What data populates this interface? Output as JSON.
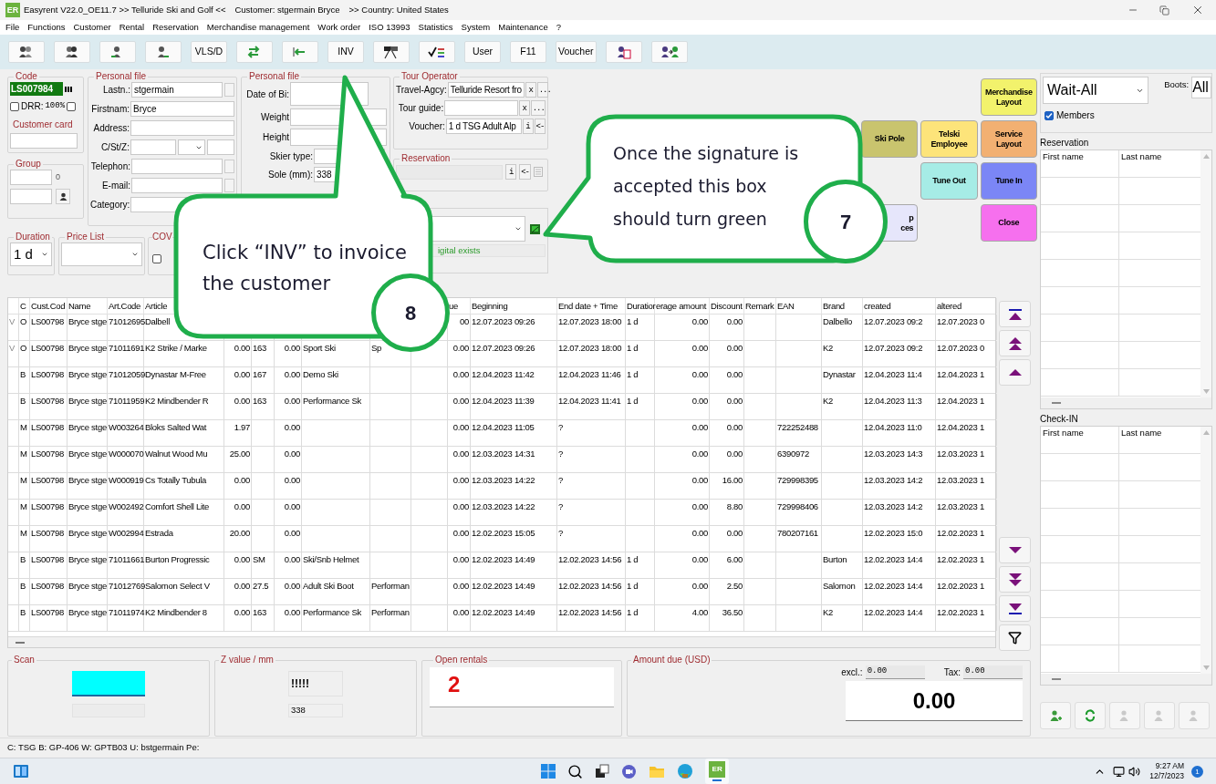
{
  "window": {
    "app_badge": "ER",
    "title": "Easyrent V22.0_OE11.7 >> Telluride Ski and Golf <<",
    "customer": "Customer: stgermain Bryce",
    "country": ">> Country: United States"
  },
  "menu": [
    "File",
    "Functions",
    "Customer",
    "Rental",
    "Reservation",
    "Merchandise management",
    "Work order",
    "ISO 13993",
    "Statistics",
    "System",
    "Maintenance",
    "?"
  ],
  "toolbar": [
    {
      "kind": "icon"
    },
    {
      "kind": "icon"
    },
    {
      "kind": "icon"
    },
    {
      "kind": "icon"
    },
    {
      "kind": "text",
      "label": "VLS/D"
    },
    {
      "kind": "icon"
    },
    {
      "kind": "icon"
    },
    {
      "kind": "text",
      "label": "INV"
    },
    {
      "kind": "icon"
    },
    {
      "kind": "icon"
    },
    {
      "kind": "text",
      "label": "User"
    },
    {
      "kind": "text",
      "label": "F11"
    },
    {
      "kind": "text",
      "label": "Voucher"
    },
    {
      "kind": "icon"
    },
    {
      "kind": "icon"
    }
  ],
  "code": {
    "title": "Code",
    "value": "LS007984",
    "drr_label": "DRR:",
    "drr_value": "100%",
    "drr_checked": false,
    "extra_checked": false,
    "customer_card": "Customer card"
  },
  "group": {
    "title": "Group",
    "count": "0"
  },
  "personal_file": {
    "title": "Personal file",
    "fields": [
      {
        "label": "Lastn.:",
        "value": "stgermain",
        "kind": "action"
      },
      {
        "label": "Firstnam:",
        "value": "Bryce",
        "kind": "plain"
      },
      {
        "label": "Address:",
        "kind": "plain"
      },
      {
        "label": "C/St/Z:",
        "kind": "triple"
      },
      {
        "label": "Telephon:",
        "kind": "action"
      },
      {
        "label": "E-mail:",
        "kind": "action"
      },
      {
        "label": "Category:",
        "kind": "plain"
      }
    ]
  },
  "body_file": {
    "title": "Personal file",
    "fields": [
      {
        "label": "Date of Bi:",
        "kind": "tall"
      },
      {
        "label": "Weight",
        "kind": "wide"
      },
      {
        "label": "Height",
        "kind": "wide"
      },
      {
        "label": "Skier type:",
        "kind": "short"
      },
      {
        "label": "Sole (mm):",
        "value": "338",
        "kind": "short"
      }
    ]
  },
  "tour_operator": {
    "title": "Tour Operator",
    "fields": [
      {
        "label": "Travel-Agcy:",
        "value": "Telluride Resort fro",
        "buttons": [
          "x",
          "..."
        ]
      },
      {
        "label": "Tour guide:",
        "buttons": [
          "x",
          "..."
        ]
      },
      {
        "label": "Voucher:",
        "value": "1 d TSG Adult Alp",
        "buttons": [
          "i",
          "<-"
        ]
      }
    ]
  },
  "reservation": {
    "title": "Reservation",
    "buttons": [
      "i",
      "<-"
    ]
  },
  "signature": {
    "status": "igital exists"
  },
  "duration": {
    "title": "Duration",
    "value": "1 d"
  },
  "price_list": {
    "title": "Price List"
  },
  "cov": {
    "title": "COV",
    "checked": false
  },
  "quick_buttons": [
    {
      "kind": "gap"
    },
    {
      "kind": "gap"
    },
    {
      "kind": "button",
      "lines": [
        "Merchandise",
        "Layout"
      ],
      "color": "#f2f26c"
    },
    {
      "kind": "button",
      "lines": [
        "Ski Pole"
      ],
      "color": "#c9c46e"
    },
    {
      "kind": "button",
      "lines": [
        "Telski",
        "Employee"
      ],
      "color": "#fde47a"
    },
    {
      "kind": "button",
      "lines": [
        "Service",
        "Layout"
      ],
      "color": "#f2b072"
    },
    {
      "kind": "gap"
    },
    {
      "kind": "button",
      "lines": [
        "Tune Out"
      ],
      "color": "#a6ece6"
    },
    {
      "kind": "button",
      "lines": [
        "Tune In"
      ],
      "color": "#7b86f6"
    },
    {
      "kind": "partial",
      "lines": [
        "p",
        "ces"
      ],
      "color": "#e6e6fb"
    },
    {
      "kind": "gap"
    },
    {
      "kind": "button",
      "lines": [
        "Close"
      ],
      "color": "#f670ee"
    }
  ],
  "table": {
    "columns": [
      "",
      "C",
      "Cust.Cod",
      "Name",
      "Art.Code",
      "Article",
      "",
      "",
      "",
      "",
      "",
      "",
      "ue",
      "Beginning",
      "End date + Time",
      "Duratior",
      "erage amount",
      "Discount",
      "Remark",
      "EAN",
      "Brand",
      "created",
      "altered"
    ],
    "rows": [
      {
        "cells": [
          "V",
          "O",
          "LS00798",
          "Bryce stge",
          "71012695",
          "Dalbell",
          "",
          "",
          "",
          "",
          "",
          "",
          "00",
          "12.07.2023 09:26",
          "12.07.2023 18:00",
          "1 d",
          "0.00",
          "0.00",
          "",
          "",
          "Dalbello",
          "12.07.2023 09:2",
          "12.07.2023 0"
        ]
      },
      {
        "cells": [
          "V",
          "O",
          "LS00798",
          "Bryce stge",
          "71011691",
          "K2 Strike / Marke",
          "0.00",
          "163",
          "0.00",
          "Sport Ski",
          "Sp",
          "",
          "0.00",
          "12.07.2023 09:26",
          "12.07.2023 18:00",
          "1 d",
          "0.00",
          "0.00",
          "",
          "",
          "K2",
          "12.07.2023 09:2",
          "12.07.2023 0"
        ]
      },
      {
        "cells": [
          "",
          "B",
          "LS00798",
          "Bryce stge",
          "71012059",
          "Dynastar M-Free",
          "0.00",
          "167",
          "0.00",
          "Demo Ski",
          "",
          "",
          "0.00",
          "12.04.2023 11:42",
          "12.04.2023 11:46",
          "1 d",
          "0.00",
          "0.00",
          "",
          "",
          "Dynastar",
          "12.04.2023 11:4",
          "12.04.2023 1"
        ]
      },
      {
        "cells": [
          "",
          "B",
          "LS00798",
          "Bryce stge",
          "71011959",
          "K2 Mindbender R",
          "0.00",
          "163",
          "0.00",
          "Performance Sk",
          "",
          "",
          "0.00",
          "12.04.2023 11:39",
          "12.04.2023 11:41",
          "1 d",
          "0.00",
          "0.00",
          "",
          "",
          "K2",
          "12.04.2023 11:3",
          "12.04.2023 1"
        ]
      },
      {
        "cells": [
          "",
          "M",
          "LS00798",
          "Bryce stge",
          "W003264",
          "Bloks Salted Wat",
          "1.97",
          "",
          "0.00",
          "",
          "",
          "",
          "0.00",
          "12.04.2023 11:05",
          "?",
          "",
          "0.00",
          "0.00",
          "",
          "722252488",
          "",
          "12.04.2023 11:0",
          "12.04.2023 1"
        ]
      },
      {
        "cells": [
          "",
          "M",
          "LS00798",
          "Bryce stge",
          "W000070",
          "Walnut Wood Mu",
          "25.00",
          "",
          "0.00",
          "",
          "",
          "",
          "0.00",
          "12.03.2023 14:31",
          "?",
          "",
          "0.00",
          "0.00",
          "",
          "6390972",
          "",
          "12.03.2023 14:3",
          "12.03.2023 1"
        ]
      },
      {
        "cells": [
          "",
          "M",
          "LS00798",
          "Bryce stge",
          "W000919",
          "Cs Totally Tubula",
          "0.00",
          "",
          "0.00",
          "",
          "",
          "",
          "0.00",
          "12.03.2023 14:22",
          "?",
          "",
          "0.00",
          "16.00",
          "",
          "729998395",
          "",
          "12.03.2023 14:2",
          "12.03.2023 1"
        ]
      },
      {
        "cells": [
          "",
          "M",
          "LS00798",
          "Bryce stge",
          "W002492",
          "Comfort Shell Lite",
          "0.00",
          "",
          "0.00",
          "",
          "",
          "",
          "0.00",
          "12.03.2023 14:22",
          "?",
          "",
          "0.00",
          "8.80",
          "",
          "729998406",
          "",
          "12.03.2023 14:2",
          "12.03.2023 1"
        ]
      },
      {
        "cells": [
          "",
          "M",
          "LS00798",
          "Bryce stge",
          "W002994",
          "Estrada",
          "20.00",
          "",
          "0.00",
          "",
          "",
          "",
          "0.00",
          "12.02.2023 15:05",
          "?",
          "",
          "0.00",
          "0.00",
          "",
          "780207161",
          "",
          "12.02.2023 15:0",
          "12.02.2023 1"
        ]
      },
      {
        "cells": [
          "",
          "B",
          "LS00798",
          "Bryce stge",
          "71011661",
          "Burton Progressic",
          "0.00",
          "SM",
          "0.00",
          "Ski/Snb Helmet",
          "",
          "",
          "0.00",
          "12.02.2023 14:49",
          "12.02.2023 14:56",
          "1 d",
          "0.00",
          "6.00",
          "",
          "",
          "Burton",
          "12.02.2023 14:4",
          "12.02.2023 1"
        ]
      },
      {
        "cells": [
          "",
          "B",
          "LS00798",
          "Bryce stge",
          "71012769",
          "Salomon Select V",
          "0.00",
          "27.5",
          "0.00",
          "Adult Ski Boot",
          "Performan",
          "",
          "0.00",
          "12.02.2023 14:49",
          "12.02.2023 14:56",
          "1 d",
          "0.00",
          "2.50",
          "",
          "",
          "Salomon",
          "12.02.2023 14:4",
          "12.02.2023 1"
        ]
      },
      {
        "cells": [
          "",
          "B",
          "LS00798",
          "Bryce stge",
          "71011974",
          "K2 Mindbender 8",
          "0.00",
          "163",
          "0.00",
          "Performance Sk",
          "Performan",
          "",
          "0.00",
          "12.02.2023 14:49",
          "12.02.2023 14:56",
          "1 d",
          "4.00",
          "36.50",
          "",
          "",
          "K2",
          "12.02.2023 14:4",
          "12.02.2023 1"
        ]
      }
    ]
  },
  "scan": {
    "title": "Scan"
  },
  "z_value": {
    "title": "Z value / mm",
    "code": "!!!!!",
    "value": "338"
  },
  "open_rentals": {
    "title": "Open rentals",
    "value": "2"
  },
  "amount_due": {
    "title": "Amount due (USD)",
    "excl_label": "excl.:",
    "excl": "0.00",
    "tax_label": "Tax:",
    "tax": "0.00",
    "total": "0.00"
  },
  "side": {
    "filter": "Wait-All",
    "boots_label": "Boots:",
    "boots": "All",
    "members_label": "Members",
    "members_checked": true,
    "lists": [
      {
        "title": "Reservation",
        "columns": [
          "First name",
          "Last name"
        ]
      },
      {
        "title": "Check-IN",
        "columns": [
          "First name",
          "Last name"
        ]
      }
    ],
    "actions": [
      {
        "disabled": false
      },
      {
        "disabled": false
      },
      {
        "disabled": true
      },
      {
        "disabled": true
      },
      {
        "disabled": true
      }
    ]
  },
  "status_bar": "C: TSG B: GP-406 W: GPTB03 U: bstgermain Pe:",
  "taskbar": {
    "app_label": "ER",
    "time": "9:27 AM",
    "date": "12/7/2023",
    "notifications": "1"
  },
  "callouts": [
    {
      "text": "Click “INV” to invoice the customer",
      "step": "8"
    },
    {
      "text": "Once the signature is accepted this box should turn green",
      "step": "7"
    }
  ]
}
